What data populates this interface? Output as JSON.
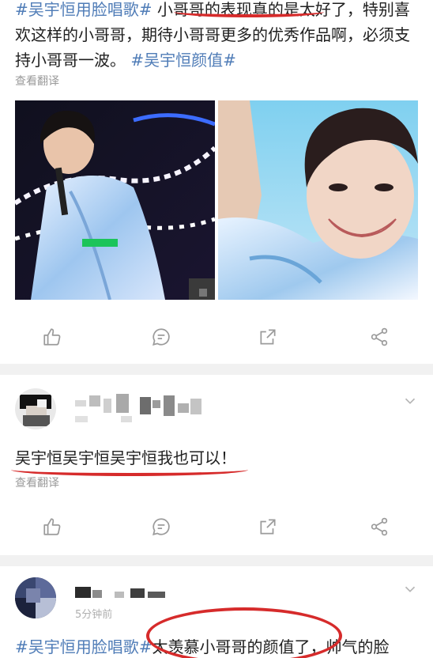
{
  "post1": {
    "segments": [
      {
        "text": "#吴宇恒用脸唱歌#",
        "type": "hashtag"
      },
      {
        "text": " 小哥哥的表现真的是太好了，特别喜欢这样的小哥哥，期待小哥哥更多的优秀作品啊，必须支持小哥哥一波。",
        "type": "plain"
      },
      {
        "text": " #吴宇恒颜值#",
        "type": "hashtag"
      }
    ],
    "translate_label": "查看翻译"
  },
  "comment1": {
    "text": "吴宇恒吴宇恒吴宇恒我也可以！",
    "translate_label": "查看翻译"
  },
  "comment2": {
    "meta_text": "5分钟前",
    "segments": [
      {
        "text": "#吴宇恒用脸唱歌#",
        "type": "hashtag"
      },
      {
        "text": "太羡慕小哥哥的颜值了，帅气的脸",
        "type": "plain"
      }
    ]
  },
  "icons": {
    "like": "thumbs-up-icon",
    "comment": "comment-icon",
    "repost": "repost-icon",
    "share": "share-icon",
    "more": "chevron-down-icon"
  },
  "colors": {
    "hashtag": "#4f7cb7",
    "annotation_red": "#d62b2b",
    "icon_gray": "#9b9b9b",
    "separator": "#f1f1f1"
  }
}
